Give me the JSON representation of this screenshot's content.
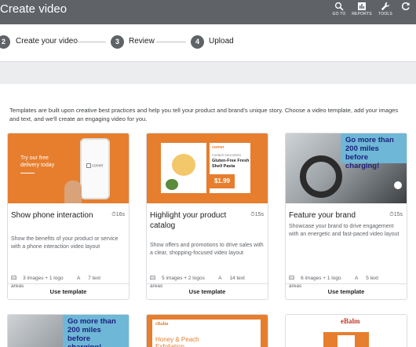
{
  "header": {
    "title": "Create video",
    "actions": [
      {
        "label": "GO TO",
        "icon": "search-icon"
      },
      {
        "label": "REPORTS",
        "icon": "reports-icon"
      },
      {
        "label": "TOOLS",
        "icon": "wrench-icon"
      },
      {
        "label": "",
        "icon": "refresh-icon"
      }
    ]
  },
  "stepper": {
    "steps": [
      {
        "num": "2",
        "label": "Create your video"
      },
      {
        "num": "3",
        "label": "Review"
      },
      {
        "num": "4",
        "label": "Upload"
      }
    ]
  },
  "intro": "Templates are built upon creative best practices and help you tell your product and brand's unique story. Choose a video template, add your images and text, and we'll create an engaging video for you.",
  "templates": [
    {
      "title": "Show phone interaction",
      "duration": "16s",
      "description": "Show the benefits of your product or service with a phone interaction video layout",
      "images": "3 images + 1 logo",
      "text_areas": "7 text areas",
      "button": "Use template",
      "thumb_text": "Try our free delivery today",
      "thumb_logo": "corner"
    },
    {
      "title": "Highlight your product catalog",
      "duration": "15s",
      "description": "Show offers and promotions to drive sales with a clear, shopping-focused video layout",
      "images": "5 images + 2 logos",
      "text_areas": "14 text areas",
      "button": "Use template",
      "thumb_brand": "corner",
      "thumb_sub": "CORNER GROCERIES",
      "thumb_product": "Gluten-Free Fresh Shell Pasta",
      "thumb_price": "$1.99"
    },
    {
      "title": "Feature your brand",
      "duration": "15s",
      "description": "Showcase your brand to drive engagement with an energetic and fast-paced video layout",
      "images": "6 images + 1 logo",
      "text_areas": "5 text areas",
      "button": "Use template",
      "thumb_banner": "Go more than 200 miles before charging!"
    }
  ],
  "bottom_cards": [
    {
      "banner": "Go more than 200 miles before charging!"
    },
    {
      "brand": "eBalm",
      "text": "Honey & Peach Exfoliation"
    },
    {
      "brand": "eBalm"
    }
  ],
  "colors": {
    "header_bg": "#5f6368",
    "orange": "#e67e2e",
    "banner_blue": "#6fb7d6"
  }
}
